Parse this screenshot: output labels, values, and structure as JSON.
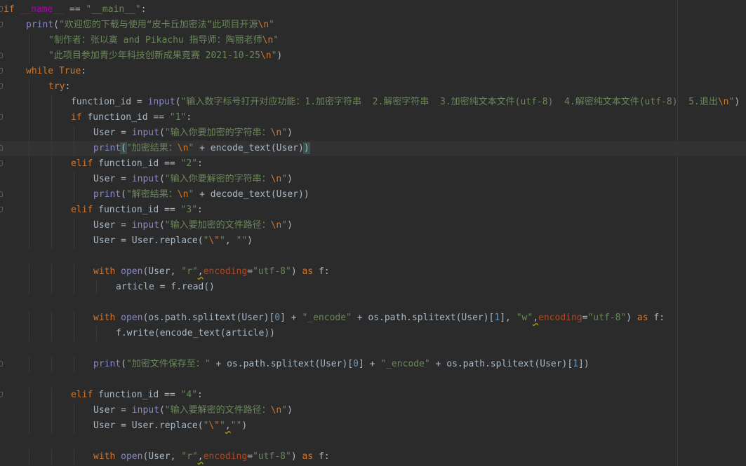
{
  "editor": {
    "lines": [
      {
        "fold": "start",
        "indent": 0,
        "tokens": [
          [
            "kw",
            "if "
          ],
          [
            "dunder",
            "__name__"
          ],
          [
            "plain",
            " == "
          ],
          [
            "str",
            "\"__main__\""
          ],
          [
            "plain",
            ":"
          ]
        ]
      },
      {
        "fold": "start",
        "indent": 1,
        "tokens": [
          [
            "bi",
            "print"
          ],
          [
            "plain",
            "("
          ],
          [
            "str",
            "\"欢迎您的下载与使用“皮卡丘加密法”此项目开源"
          ],
          [
            "esc",
            "\\n"
          ],
          [
            "str",
            "\""
          ]
        ]
      },
      {
        "fold": "",
        "indent": 2,
        "tokens": [
          [
            "str",
            "\"制作者：张以寞 and Pikachu 指导师：陶丽老师"
          ],
          [
            "esc",
            "\\n"
          ],
          [
            "str",
            "\""
          ]
        ]
      },
      {
        "fold": "end",
        "indent": 2,
        "tokens": [
          [
            "str",
            "\"此项目参加青少年科技创新成果竞赛 2021-10-25"
          ],
          [
            "esc",
            "\\n"
          ],
          [
            "str",
            "\""
          ],
          [
            "plain",
            ")"
          ]
        ]
      },
      {
        "fold": "start",
        "indent": 1,
        "tokens": [
          [
            "kw",
            "while "
          ],
          [
            "kw",
            "True"
          ],
          [
            "plain",
            ":"
          ]
        ]
      },
      {
        "fold": "start",
        "indent": 2,
        "tokens": [
          [
            "kw",
            "try"
          ],
          [
            "plain",
            ":"
          ]
        ]
      },
      {
        "fold": "",
        "indent": 3,
        "tokens": [
          [
            "plain",
            "function_id = "
          ],
          [
            "bi",
            "input"
          ],
          [
            "plain",
            "("
          ],
          [
            "str",
            "\"输入数字标号打开对应功能：1.加密字符串  2.解密字符串  3.加密纯文本文件(utf-8)  4.解密纯文本文件(utf-8)  5.退出"
          ],
          [
            "esc",
            "\\n"
          ],
          [
            "str",
            "\""
          ],
          [
            "plain",
            ")"
          ]
        ]
      },
      {
        "fold": "start",
        "indent": 3,
        "tokens": [
          [
            "kw",
            "if "
          ],
          [
            "plain",
            "function_id == "
          ],
          [
            "str",
            "\"1\""
          ],
          [
            "plain",
            ":"
          ]
        ]
      },
      {
        "fold": "",
        "indent": 4,
        "tokens": [
          [
            "plain",
            "User = "
          ],
          [
            "bi",
            "input"
          ],
          [
            "plain",
            "("
          ],
          [
            "str",
            "\"输入你要加密的字符串："
          ],
          [
            "esc",
            "\\n"
          ],
          [
            "str",
            "\""
          ],
          [
            "plain",
            ")"
          ]
        ]
      },
      {
        "fold": "end",
        "indent": 4,
        "current": true,
        "tokens": [
          [
            "bi",
            "print"
          ],
          [
            "brace",
            "("
          ],
          [
            "str",
            "\"加密结果："
          ],
          [
            "esc",
            "\\n"
          ],
          [
            "str",
            "\""
          ],
          [
            "plain",
            " + encode_text(User)"
          ],
          [
            "brace",
            ")"
          ]
        ]
      },
      {
        "fold": "start",
        "indent": 3,
        "tokens": [
          [
            "kw",
            "elif "
          ],
          [
            "plain",
            "function_id == "
          ],
          [
            "str",
            "\"2\""
          ],
          [
            "plain",
            ":"
          ]
        ]
      },
      {
        "fold": "",
        "indent": 4,
        "tokens": [
          [
            "plain",
            "User = "
          ],
          [
            "bi",
            "input"
          ],
          [
            "plain",
            "("
          ],
          [
            "str",
            "\"输入你要解密的字符串："
          ],
          [
            "esc",
            "\\n"
          ],
          [
            "str",
            "\""
          ],
          [
            "plain",
            ")"
          ]
        ]
      },
      {
        "fold": "end",
        "indent": 4,
        "tokens": [
          [
            "bi",
            "print"
          ],
          [
            "plain",
            "("
          ],
          [
            "str",
            "\"解密结果："
          ],
          [
            "esc",
            "\\n"
          ],
          [
            "str",
            "\""
          ],
          [
            "plain",
            " + decode_text(User))"
          ]
        ]
      },
      {
        "fold": "start",
        "indent": 3,
        "tokens": [
          [
            "kw",
            "elif "
          ],
          [
            "plain",
            "function_id == "
          ],
          [
            "str",
            "\"3\""
          ],
          [
            "plain",
            ":"
          ]
        ]
      },
      {
        "fold": "",
        "indent": 4,
        "tokens": [
          [
            "plain",
            "User = "
          ],
          [
            "bi",
            "input"
          ],
          [
            "plain",
            "("
          ],
          [
            "str",
            "\"输入要加密的文件路径："
          ],
          [
            "esc",
            "\\n"
          ],
          [
            "str",
            "\""
          ],
          [
            "plain",
            ")"
          ]
        ]
      },
      {
        "fold": "",
        "indent": 4,
        "tokens": [
          [
            "plain",
            "User = User.replace("
          ],
          [
            "str",
            "\""
          ],
          [
            "esc",
            "\\\""
          ],
          [
            "str",
            "\""
          ],
          [
            "plain",
            ", "
          ],
          [
            "str",
            "\"\""
          ],
          [
            "plain",
            ")"
          ]
        ]
      },
      {
        "fold": "",
        "indent": 0,
        "tokens": []
      },
      {
        "fold": "",
        "indent": 4,
        "tokens": [
          [
            "kw",
            "with "
          ],
          [
            "bi",
            "open"
          ],
          [
            "plain",
            "(User, "
          ],
          [
            "str",
            "\"r\""
          ],
          [
            "typo",
            ","
          ],
          [
            "kwarg",
            "encoding"
          ],
          [
            "plain",
            "="
          ],
          [
            "str",
            "\"utf-8\""
          ],
          [
            "plain",
            ") "
          ],
          [
            "kw",
            "as "
          ],
          [
            "plain",
            "f:"
          ]
        ]
      },
      {
        "fold": "",
        "indent": 5,
        "tokens": [
          [
            "plain",
            "article = f.read()"
          ]
        ]
      },
      {
        "fold": "",
        "indent": 0,
        "tokens": []
      },
      {
        "fold": "",
        "indent": 4,
        "tokens": [
          [
            "kw",
            "with "
          ],
          [
            "bi",
            "open"
          ],
          [
            "plain",
            "(os.path.splitext(User)["
          ],
          [
            "num",
            "0"
          ],
          [
            "plain",
            "] + "
          ],
          [
            "str",
            "\"_encode\""
          ],
          [
            "plain",
            " + os.path.splitext(User)["
          ],
          [
            "num",
            "1"
          ],
          [
            "plain",
            "], "
          ],
          [
            "str",
            "\"w\""
          ],
          [
            "typo",
            ","
          ],
          [
            "kwarg",
            "encoding"
          ],
          [
            "plain",
            "="
          ],
          [
            "str",
            "\"utf-8\""
          ],
          [
            "plain",
            ") "
          ],
          [
            "kw",
            "as "
          ],
          [
            "plain",
            "f:"
          ]
        ]
      },
      {
        "fold": "",
        "indent": 5,
        "tokens": [
          [
            "plain",
            "f.write(encode_text(article))"
          ]
        ]
      },
      {
        "fold": "",
        "indent": 0,
        "tokens": []
      },
      {
        "fold": "end",
        "indent": 4,
        "tokens": [
          [
            "bi",
            "print"
          ],
          [
            "plain",
            "("
          ],
          [
            "str",
            "\"加密文件保存至：\""
          ],
          [
            "plain",
            " + os.path.splitext(User)["
          ],
          [
            "num",
            "0"
          ],
          [
            "plain",
            "] + "
          ],
          [
            "str",
            "\"_encode\""
          ],
          [
            "plain",
            " + os.path.splitext(User)["
          ],
          [
            "num",
            "1"
          ],
          [
            "plain",
            "])"
          ]
        ]
      },
      {
        "fold": "",
        "indent": 0,
        "tokens": []
      },
      {
        "fold": "start",
        "indent": 3,
        "tokens": [
          [
            "kw",
            "elif "
          ],
          [
            "plain",
            "function_id == "
          ],
          [
            "str",
            "\"4\""
          ],
          [
            "plain",
            ":"
          ]
        ]
      },
      {
        "fold": "",
        "indent": 4,
        "tokens": [
          [
            "plain",
            "User = "
          ],
          [
            "bi",
            "input"
          ],
          [
            "plain",
            "("
          ],
          [
            "str",
            "\"输入要解密的文件路径："
          ],
          [
            "esc",
            "\\n"
          ],
          [
            "str",
            "\""
          ],
          [
            "plain",
            ")"
          ]
        ]
      },
      {
        "fold": "",
        "indent": 4,
        "tokens": [
          [
            "plain",
            "User = User.replace("
          ],
          [
            "str",
            "\""
          ],
          [
            "esc",
            "\\\""
          ],
          [
            "str",
            "\""
          ],
          [
            "typo",
            ","
          ],
          [
            "str",
            "\"\""
          ],
          [
            "plain",
            ")"
          ]
        ]
      },
      {
        "fold": "",
        "indent": 0,
        "tokens": []
      },
      {
        "fold": "",
        "indent": 4,
        "tokens": [
          [
            "kw",
            "with "
          ],
          [
            "bi",
            "open"
          ],
          [
            "plain",
            "(User, "
          ],
          [
            "str",
            "\"r\""
          ],
          [
            "typo",
            ","
          ],
          [
            "kwarg",
            "encoding"
          ],
          [
            "plain",
            "="
          ],
          [
            "str",
            "\"utf-8\""
          ],
          [
            "plain",
            ") "
          ],
          [
            "kw",
            "as "
          ],
          [
            "plain",
            "f:"
          ]
        ]
      }
    ]
  }
}
